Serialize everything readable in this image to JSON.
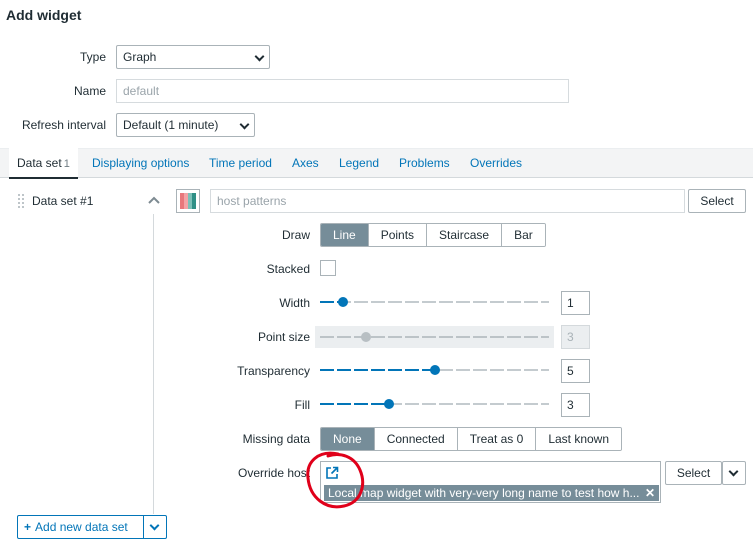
{
  "header": {
    "title": "Add widget"
  },
  "form": {
    "type_label": "Type",
    "type_value": "Graph",
    "name_label": "Name",
    "name_placeholder": "default",
    "refresh_label": "Refresh interval",
    "refresh_value": "Default (1 minute)"
  },
  "tabs": [
    {
      "label": "Data set",
      "count": "1"
    },
    {
      "label": "Displaying options"
    },
    {
      "label": "Time period"
    },
    {
      "label": "Axes"
    },
    {
      "label": "Legend"
    },
    {
      "label": "Problems"
    },
    {
      "label": "Overrides"
    }
  ],
  "dataset": {
    "name": "Data set #1",
    "host_placeholder": "host patterns",
    "select_label": "Select",
    "palette_colors": [
      "#e8787c",
      "#f4a3a6",
      "#7cc0b8",
      "#4aa79d",
      "#2f8f86"
    ]
  },
  "draw": {
    "label": "Draw",
    "options": [
      "Line",
      "Points",
      "Staircase",
      "Bar"
    ],
    "selected": "Line"
  },
  "stacked": {
    "label": "Stacked"
  },
  "width": {
    "label": "Width",
    "value": "1",
    "fraction": 0.1
  },
  "point_size": {
    "label": "Point size",
    "value": "3",
    "fraction": 0.2
  },
  "transparency": {
    "label": "Transparency",
    "value": "5",
    "fraction": 0.5
  },
  "fill": {
    "label": "Fill",
    "value": "3",
    "fraction": 0.3
  },
  "missing": {
    "label": "Missing data",
    "options": [
      "None",
      "Connected",
      "Treat as 0",
      "Last known"
    ],
    "selected": "None"
  },
  "override": {
    "label": "Override host",
    "tag_text": "Local map widget with very-very long name to test how h...",
    "select_label": "Select"
  },
  "footer": {
    "add_label": "Add new data set"
  },
  "colors": {
    "accent": "#0275b8",
    "selected": "#768d99",
    "annotation": "#e0001a"
  }
}
